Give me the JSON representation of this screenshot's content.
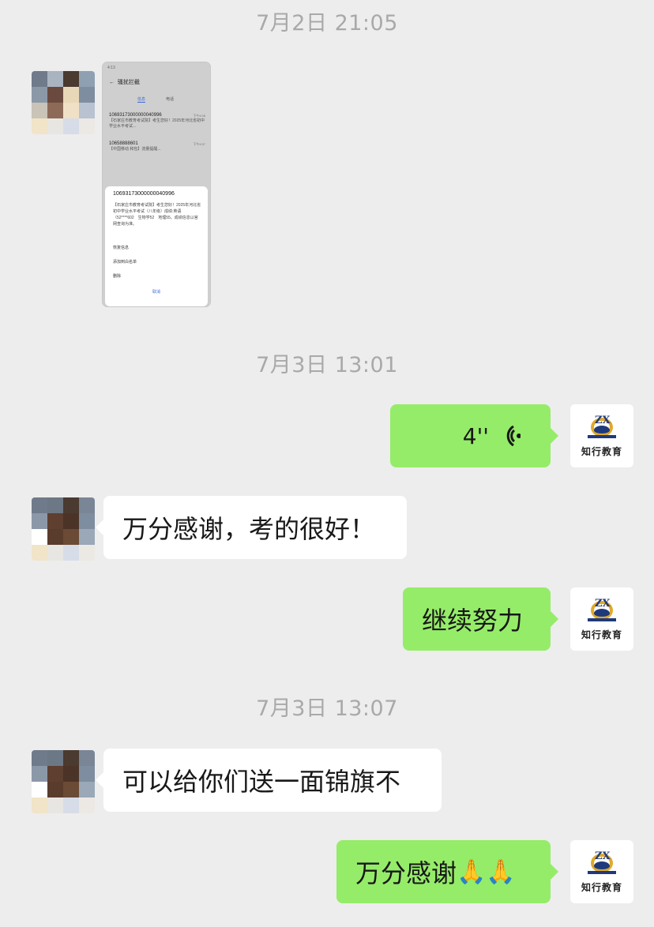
{
  "timestamps": [
    "7月2日 21:05",
    "7月3日 13:01",
    "7月3日 13:07"
  ],
  "screenshot": {
    "status": "4:13",
    "header": "骚扰拦截",
    "tabs": [
      "信息",
      "电话"
    ],
    "items": [
      {
        "number": "10693173000000040996",
        "time": "下午4:08",
        "text": "【石家庄市教育考试院】考生您好！2025年河北省初中学业水平考试..."
      },
      {
        "number": "10658888601",
        "time": "下午4:57",
        "text": "【中国移动 和包】流量提醒..."
      }
    ],
    "sheet": {
      "number": "10693173000000040996",
      "body": "【石家庄市教育考试院】考生您好！2025年河北省初中学业水平考试（八年级）成绩:英语（52****602　生物学52　地理55。成绩信息以官网查询为准。",
      "options": [
        "恢复信息",
        "添加到白名单",
        "删除"
      ],
      "cancel": "取消"
    }
  },
  "messages": [
    {
      "side": "out",
      "type": "voice",
      "duration": "4''"
    },
    {
      "side": "in",
      "text": "万分感谢，考的很好！"
    },
    {
      "side": "out",
      "text": "继续努力"
    },
    {
      "side": "in",
      "text": "可以给你们送一面锦旗不"
    },
    {
      "side": "out",
      "text": "万分感谢",
      "emoji": "🙏🙏"
    }
  ],
  "logo": {
    "letters": "ZX",
    "name": "知行教育"
  },
  "colors": {
    "background": "#ededed",
    "out_bubble": "#95ec69",
    "in_bubble": "#ffffff",
    "timestamp": "#a9a9a9"
  }
}
